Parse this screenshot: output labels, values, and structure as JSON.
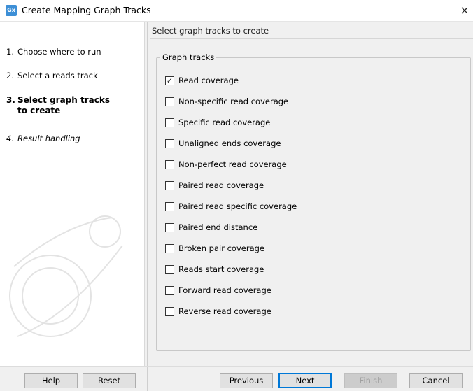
{
  "window": {
    "app_icon_text": "Gx",
    "title": "Create Mapping Graph Tracks",
    "close_glyph": "×"
  },
  "steps": [
    {
      "num": "1.",
      "label": "Choose where to run",
      "state": "normal"
    },
    {
      "num": "2.",
      "label": "Select a reads track",
      "state": "normal"
    },
    {
      "num": "3.",
      "label": "Select graph tracks to create",
      "state": "current"
    },
    {
      "num": "4.",
      "label": "Result handling",
      "state": "future"
    }
  ],
  "main": {
    "header": "Select graph tracks to create",
    "group_title": "Graph tracks",
    "tracks": [
      {
        "label": "Read coverage",
        "checked": true
      },
      {
        "label": "Non-specific read coverage",
        "checked": false
      },
      {
        "label": "Specific read coverage",
        "checked": false
      },
      {
        "label": "Unaligned ends coverage",
        "checked": false
      },
      {
        "label": "Non-perfect read coverage",
        "checked": false
      },
      {
        "label": "Paired read coverage",
        "checked": false
      },
      {
        "label": "Paired read specific coverage",
        "checked": false
      },
      {
        "label": "Paired end distance",
        "checked": false
      },
      {
        "label": "Broken pair coverage",
        "checked": false
      },
      {
        "label": "Reads start coverage",
        "checked": false
      },
      {
        "label": "Forward read coverage",
        "checked": false
      },
      {
        "label": "Reverse read coverage",
        "checked": false
      }
    ]
  },
  "buttons": {
    "help": "Help",
    "reset": "Reset",
    "previous": "Previous",
    "next": "Next",
    "finish": "Finish",
    "cancel": "Cancel"
  },
  "icons": {
    "checkmark": "✓"
  },
  "colors": {
    "accent": "#0078d7",
    "app_icon": "#3d8fd6"
  }
}
